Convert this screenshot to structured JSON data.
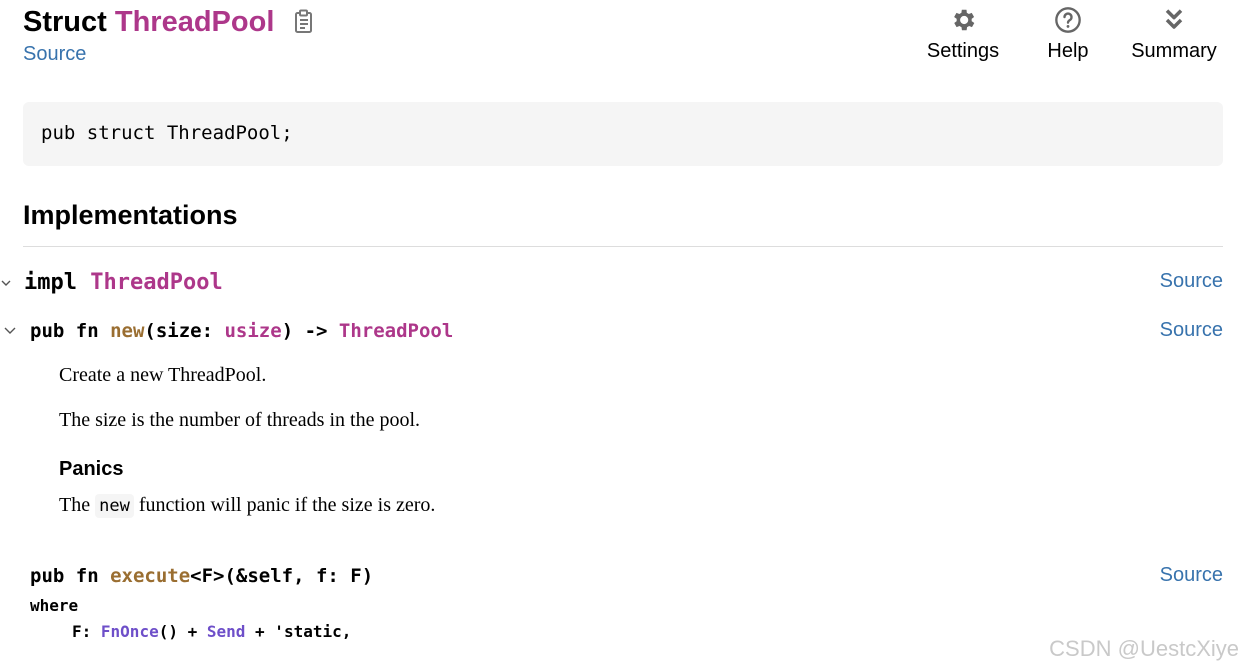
{
  "header": {
    "kind": "Struct",
    "name": "ThreadPool",
    "source_link": "Source",
    "copy_icon": "clipboard-icon"
  },
  "toolbar": {
    "settings": {
      "label": "Settings",
      "icon": "gear-icon"
    },
    "help": {
      "label": "Help",
      "icon": "question-circle-icon"
    },
    "summary": {
      "label": "Summary",
      "icon": "double-chevron-down-icon"
    }
  },
  "declaration": "pub struct ThreadPool;",
  "implementations": {
    "heading": "Implementations",
    "impl_block": {
      "keyword": "impl",
      "type": "ThreadPool",
      "source_link": "Source"
    },
    "methods": [
      {
        "sig_pub_fn": "pub fn ",
        "name": "new",
        "sig_open": "(size: ",
        "param_type": "usize",
        "sig_arrow": ") -> ",
        "return_type": "ThreadPool",
        "source_link": "Source",
        "doc_lines": [
          "Create a new ThreadPool.",
          "The size is the number of threads in the pool."
        ],
        "panics_heading": "Panics",
        "panics_pre": "The ",
        "panics_code": "new",
        "panics_post": " function will panic if the size is zero."
      },
      {
        "sig_pub_fn": "pub fn ",
        "name": "execute",
        "sig_rest": "<F>(&self, f: F)",
        "where_kw": "where",
        "bound_pre": "F: ",
        "bound_trait1": "FnOnce",
        "bound_mid": "() + ",
        "bound_trait2": "Send",
        "bound_post": " + 'static,",
        "source_link": "Source"
      }
    ]
  },
  "colors": {
    "struct": "#ad378a",
    "function": "#9a6e31",
    "trait": "#6e4fc9",
    "link": "#3873ad"
  },
  "watermark": "CSDN @UestcXiye"
}
